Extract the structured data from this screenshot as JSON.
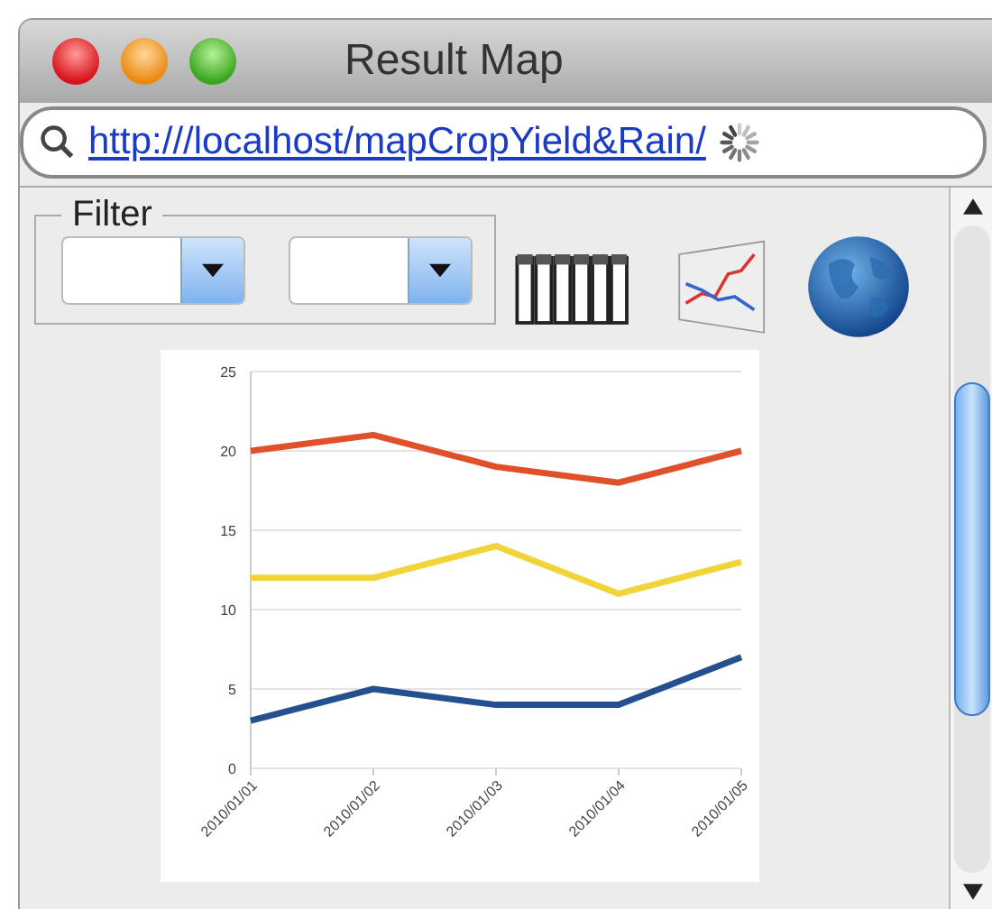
{
  "window": {
    "title": "Result Map"
  },
  "address_bar": {
    "url": "http:///localhost/mapCropYield&Rain/",
    "loading": true
  },
  "filter": {
    "label": "Filter",
    "dropdowns": [
      {
        "kind": "combo"
      },
      {
        "kind": "combo"
      }
    ]
  },
  "chart": {
    "chart_data": {
      "type": "line",
      "categories": [
        "2010/01/01",
        "2010/01/02",
        "2010/01/03",
        "2010/01/04",
        "2010/01/05"
      ],
      "ylim": [
        0,
        25
      ],
      "yticks": [
        0,
        5,
        10,
        15,
        20,
        25
      ],
      "grid": true,
      "series": [
        {
          "color": "#e0502a",
          "values": [
            20,
            21,
            19,
            18,
            20
          ]
        },
        {
          "color": "#f0d43a",
          "values": [
            12,
            12,
            14,
            11,
            13
          ]
        },
        {
          "color": "#24508f",
          "values": [
            3,
            5,
            4,
            4,
            7
          ]
        }
      ]
    }
  }
}
